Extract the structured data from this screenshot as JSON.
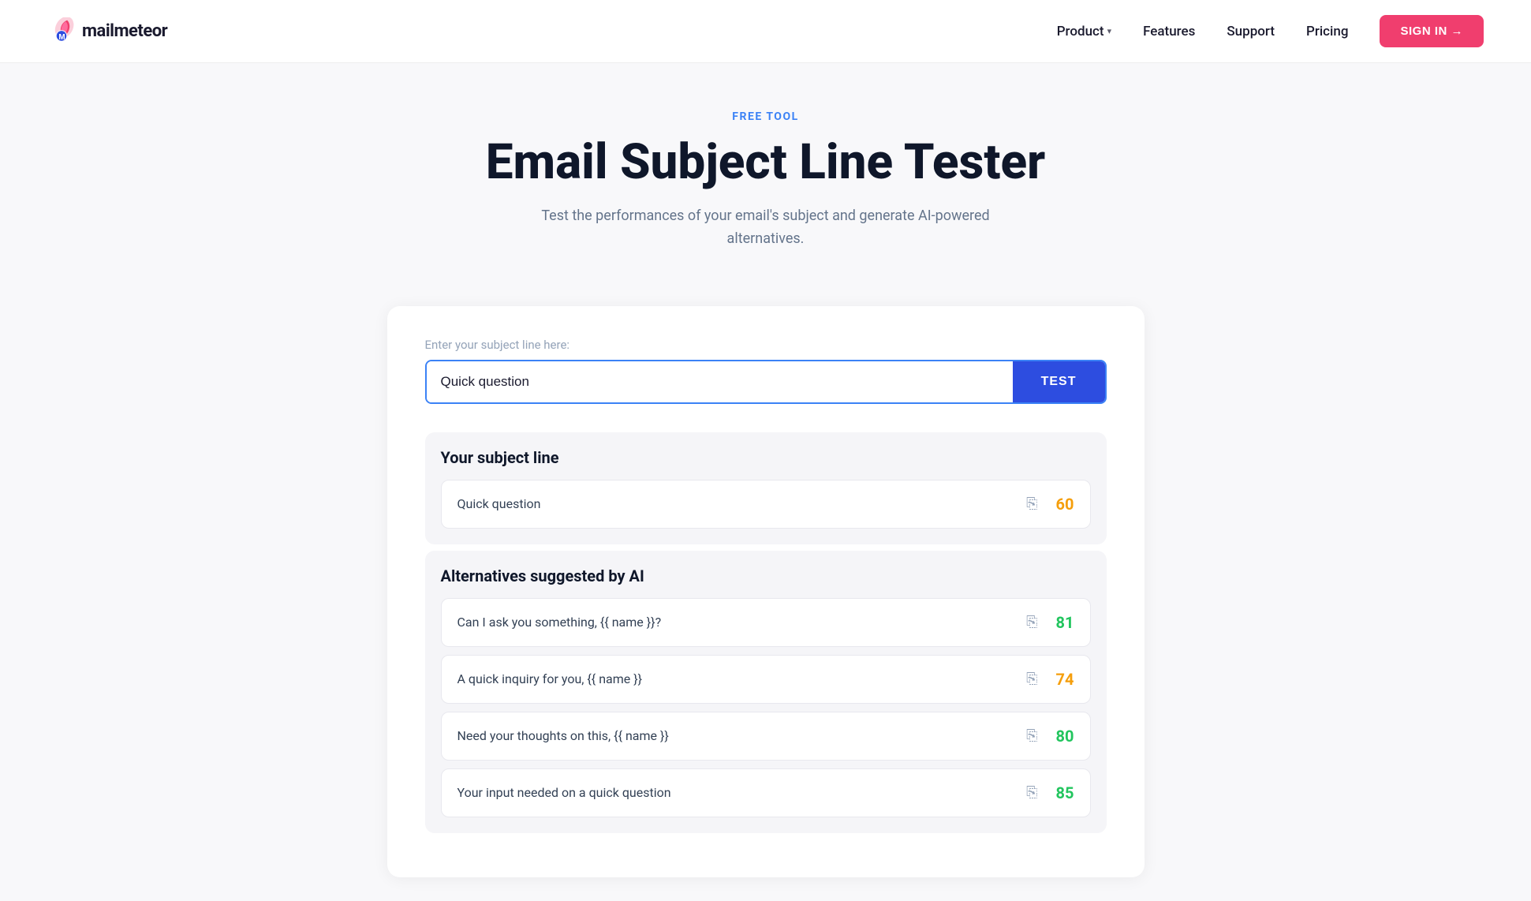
{
  "brand": {
    "name": "mailmeteor",
    "logo_icon": "meteor"
  },
  "nav": {
    "links": [
      {
        "label": "Product",
        "has_dropdown": true
      },
      {
        "label": "Features",
        "has_dropdown": false
      },
      {
        "label": "Support",
        "has_dropdown": false
      },
      {
        "label": "Pricing",
        "has_dropdown": false
      }
    ],
    "cta_label": "SIGN IN →"
  },
  "hero": {
    "badge": "FREE TOOL",
    "title": "Email Subject Line Tester",
    "subtitle": "Test the performances of your email's subject and generate AI-powered alternatives."
  },
  "tool": {
    "input_label": "Enter your subject line here:",
    "input_placeholder": "Quick question",
    "input_value": "Quick question",
    "test_button_label": "TEST"
  },
  "your_subject_line": {
    "section_title": "Your subject line",
    "item": {
      "text": "Quick question",
      "score": "60",
      "score_color": "orange"
    }
  },
  "alternatives": {
    "section_title": "Alternatives suggested by AI",
    "items": [
      {
        "text": "Can I ask you something, {{ name }}?",
        "score": "81",
        "score_color": "green"
      },
      {
        "text": "A quick inquiry for you, {{ name }}",
        "score": "74",
        "score_color": "orange"
      },
      {
        "text": "Need your thoughts on this, {{ name }}",
        "score": "80",
        "score_color": "green"
      },
      {
        "text": "Your input needed on a quick question",
        "score": "85",
        "score_color": "green"
      }
    ]
  }
}
